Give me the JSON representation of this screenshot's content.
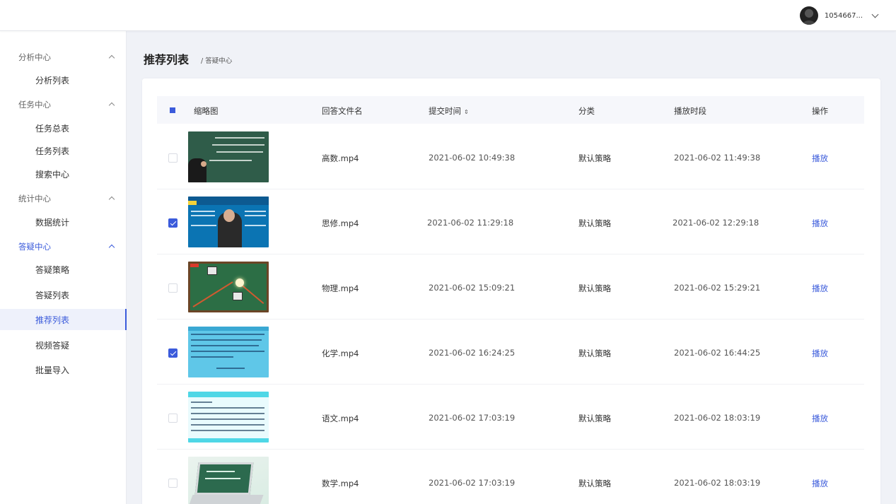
{
  "header": {
    "user_name": "1054667..."
  },
  "sidebar": {
    "groups": [
      {
        "label": "分析中心",
        "items": [
          "分析列表"
        ]
      },
      {
        "label": "任务中心",
        "items": [
          "任务总表",
          "任务列表",
          "搜索中心"
        ]
      },
      {
        "label": "统计中心",
        "items": [
          "数据统计"
        ]
      },
      {
        "label": "答疑中心",
        "items": [
          "答疑策略",
          "答疑列表",
          "推荐列表",
          "视频答疑",
          "批量导入"
        ]
      }
    ],
    "active_group": "答疑中心",
    "active_item": "推荐列表"
  },
  "page": {
    "title": "推荐列表",
    "breadcrumb": "/ 答疑中心"
  },
  "table": {
    "columns": [
      "缩略图",
      "回答文件名",
      "提交时间",
      "分类",
      "播放时段",
      "操作"
    ],
    "sort_icon": "sort-icon",
    "rows": [
      {
        "checked": false,
        "file": "高数.mp4",
        "submitted": "2021-06-02 10:49:38",
        "category": "默认策略",
        "play_time": "2021-06-02 11:49:38",
        "action": "播放"
      },
      {
        "checked": true,
        "file": "思修.mp4",
        "submitted": "2021-06-02 11:29:18",
        "category": "默认策略",
        "play_time": "2021-06-02 12:29:18",
        "action": "播放"
      },
      {
        "checked": false,
        "file": "物理.mp4",
        "submitted": "2021-06-02 15:09:21",
        "category": "默认策略",
        "play_time": "2021-06-02 15:29:21",
        "action": "播放"
      },
      {
        "checked": true,
        "file": "化学.mp4",
        "submitted": "2021-06-02 16:24:25",
        "category": "默认策略",
        "play_time": "2021-06-02 16:44:25",
        "action": "播放"
      },
      {
        "checked": false,
        "file": "语文.mp4",
        "submitted": "2021-06-02 17:03:19",
        "category": "默认策略",
        "play_time": "2021-06-02 18:03:19",
        "action": "播放"
      },
      {
        "checked": false,
        "file": "数学.mp4",
        "submitted": "2021-06-02 17:03:19",
        "category": "默认策略",
        "play_time": "2021-06-02 18:03:19",
        "action": "播放"
      }
    ]
  },
  "colors": {
    "accent": "#3b5bdb",
    "background": "#f0f2f7"
  }
}
